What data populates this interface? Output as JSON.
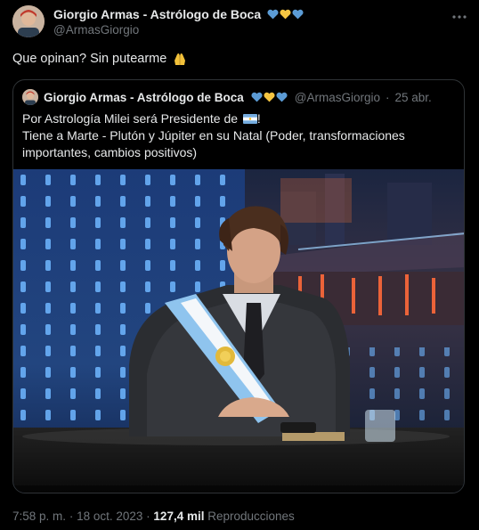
{
  "tweet": {
    "author_name": "Giorgio Armas - Astrólogo de Boca",
    "author_handle": "@ArmasGiorgio",
    "text": "Que opinan? Sin putearme",
    "more_icon": "more-icon",
    "hearts": [
      "#5b9bd5",
      "#f5c542",
      "#5b9bd5"
    ]
  },
  "quoted": {
    "author_name": "Giorgio Armas - Astrólogo de Boca",
    "author_handle": "@ArmasGiorgio",
    "separator": "·",
    "date": "25 abr.",
    "line1": "Por Astrología Milei será Presidente de",
    "line1_end": "!",
    "line2": "Tiene a Marte - Plutón y Júpiter en su Natal (Poder, transformaciones importantes, cambios positivos)"
  },
  "footer": {
    "time": "7:58 p. m.",
    "separator": "·",
    "date": "18 oct. 2023",
    "separator2": "·",
    "views_count": "127,4 mil",
    "views_label": "Reproducciones"
  },
  "colors": {
    "background": "#000000",
    "text": "#e7e9ea",
    "muted": "#71767b",
    "border": "#2f3336"
  }
}
